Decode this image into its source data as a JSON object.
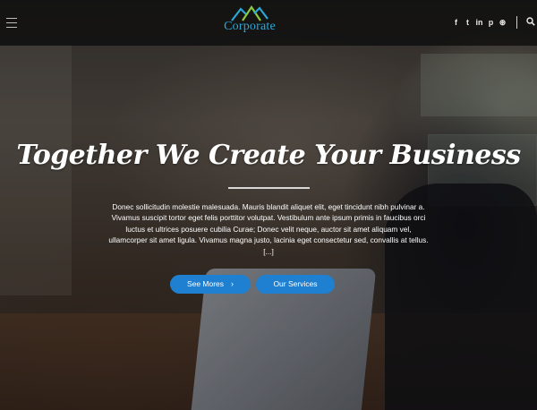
{
  "header": {
    "logo_text": "Corporate",
    "social_icons": [
      "facebook-icon",
      "twitter-icon",
      "linkedin-icon",
      "pinterest-icon",
      "dribbble-icon"
    ],
    "social_glyphs": [
      "f",
      "t",
      "in",
      "p",
      "⊛"
    ]
  },
  "hero": {
    "title": "Together We Create Your Business",
    "description": "Donec sollicitudin molestie malesuada. Mauris blandit aliquet elit, eget tincidunt nibh pulvinar a. Vivamus suscipit tortor eget felis porttitor volutpat. Vestibulum ante ipsum primis in faucibus orci luctus et ultrices posuere cubilia Curae; Donec velit neque, auctor sit amet aliquam vel, ullamcorper sit amet ligula. Vivamus magna justo, lacinia eget consectetur sed, convallis at tellus. [...]",
    "button_more": "See Mores",
    "button_services": "Our Services"
  },
  "colors": {
    "accent": "#1f7fd0",
    "logo_blue": "#2aa8d8",
    "logo_green": "#8dc63f"
  }
}
